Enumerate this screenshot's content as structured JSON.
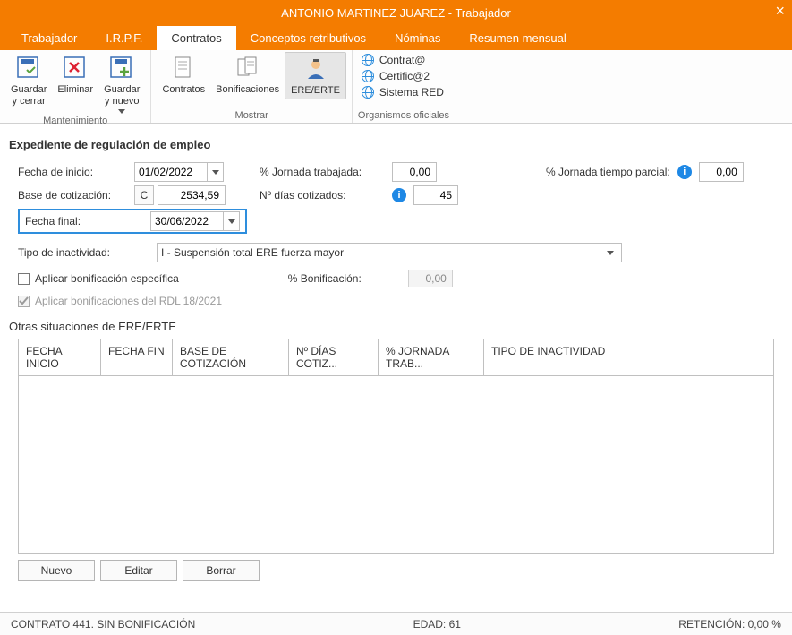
{
  "window": {
    "title": "ANTONIO MARTINEZ JUAREZ - Trabajador"
  },
  "tabs": {
    "trabajador": "Trabajador",
    "irpf": "I.R.P.F.",
    "contratos": "Contratos",
    "conceptos": "Conceptos retributivos",
    "nominas": "Nóminas",
    "resumen": "Resumen mensual"
  },
  "ribbon": {
    "mantenimiento": {
      "label": "Mantenimiento",
      "guardar_cerrar": "Guardar\ny cerrar",
      "eliminar": "Eliminar",
      "guardar_nuevo": "Guardar\ny nuevo"
    },
    "mostrar": {
      "label": "Mostrar",
      "contratos": "Contratos",
      "bonificaciones": "Bonificaciones",
      "ere": "ERE/ERTE"
    },
    "organismos": {
      "label": "Organismos oficiales",
      "contrat": "Contrat@",
      "certific": "Certific@2",
      "sistema_red": "Sistema RED"
    }
  },
  "section": {
    "title": "Expediente de regulación de empleo"
  },
  "form": {
    "fecha_inicio_lbl": "Fecha de inicio:",
    "fecha_inicio": "01/02/2022",
    "base_cot_lbl": "Base de cotización:",
    "base_cot_btn": "C",
    "base_cot": "2534,59",
    "fecha_final_lbl": "Fecha final:",
    "fecha_final": "30/06/2022",
    "tipo_inact_lbl": "Tipo de inactividad:",
    "tipo_inact_val": "I - Suspensión total ERE fuerza mayor",
    "aplicar_bon_lbl": "Aplicar bonificación específica",
    "aplicar_rdl_lbl": "Aplicar bonificaciones del RDL 18/2021",
    "pct_bon_lbl": "% Bonificación:",
    "pct_bon_val": "0,00",
    "pct_jornada_lbl": "% Jornada trabajada:",
    "pct_jornada_val": "0,00",
    "num_dias_lbl": "Nº días cotizados:",
    "num_dias_val": "45",
    "pct_parcial_lbl": "% Jornada tiempo parcial:",
    "pct_parcial_val": "0,00"
  },
  "otras": {
    "title": "Otras situaciones de ERE/ERTE"
  },
  "grid": {
    "cols": {
      "fecha_inicio": "FECHA INICIO",
      "fecha_fin": "FECHA FIN",
      "base": "BASE DE COTIZACIÓN",
      "dias": "Nº DÍAS COTIZ...",
      "jornada": "% JORNADA TRAB...",
      "tipo": "TIPO DE INACTIVIDAD"
    },
    "buttons": {
      "nuevo": "Nuevo",
      "editar": "Editar",
      "borrar": "Borrar"
    }
  },
  "status": {
    "left": "CONTRATO 441.  SIN BONIFICACIÓN",
    "edad": "EDAD: 61",
    "retencion": "RETENCIÓN: 0,00 %"
  }
}
